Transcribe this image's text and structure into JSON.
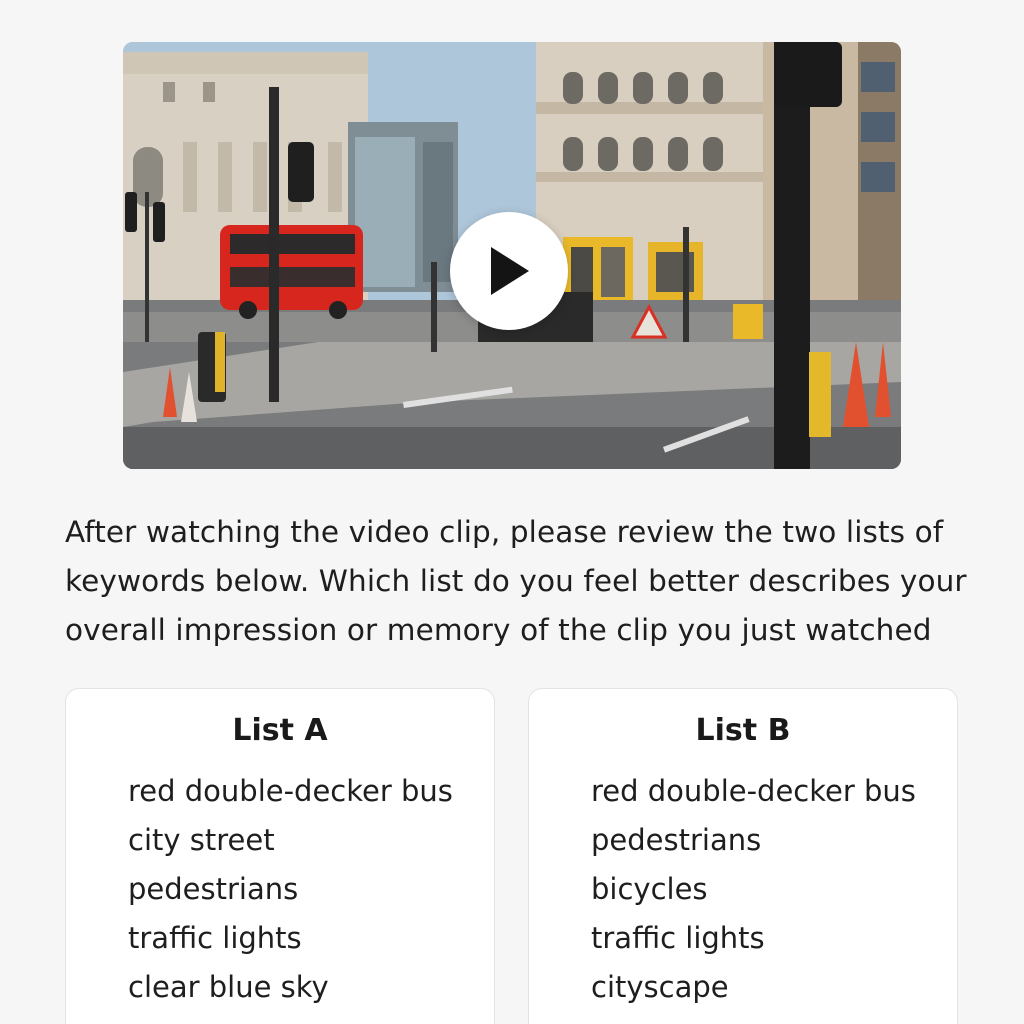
{
  "video": {
    "play_icon": "play-icon"
  },
  "question": {
    "text": "After watching the video clip, please review the two lists of keywords below. Which list do you feel better describes your overall impression or memory of the clip you just watched"
  },
  "lists": [
    {
      "title": "List A",
      "items": [
        "red double-decker bus",
        "city street",
        "pedestrians",
        "traffic lights",
        "clear blue sky"
      ]
    },
    {
      "title": "List B",
      "items": [
        "red double-decker bus",
        "pedestrians",
        "bicycles",
        "traffic lights",
        "cityscape"
      ]
    }
  ],
  "colors": {
    "page_background": "#f6f6f6",
    "card_background": "#ffffff",
    "play_button": "#ffffff",
    "play_glyph": "#141414"
  }
}
